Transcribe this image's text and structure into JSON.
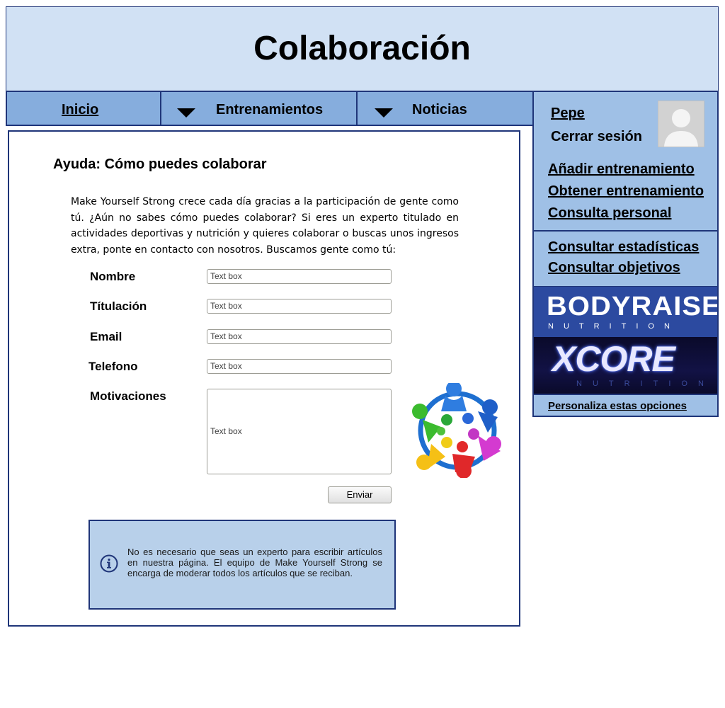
{
  "header": {
    "title": "Colaboración"
  },
  "nav": {
    "home": "Inicio",
    "trainings": "Entrenamientos",
    "news": "Noticias"
  },
  "help": {
    "title": "Ayuda: Cómo puedes colaborar",
    "intro": "Make Yourself Strong crece cada día gracias a la participación de gente como tú. ¿Aún no sabes cómo puedes colaborar? Si eres un experto titulado en actividades deportivas y nutrición y quieres colaborar o buscas unos ingresos extra, ponte en contacto con nosotros. Buscamos gente como tú:"
  },
  "form": {
    "name_label": "Nombre",
    "degree_label": "Títulación",
    "email_label": "Email",
    "phone_label": "Telefono",
    "motivation_label": "Motivaciones",
    "name_value": "Text box",
    "degree_value": "Text box",
    "email_value": "Text box",
    "phone_value": "Text box",
    "motivation_value": "Text box",
    "submit": "Enviar"
  },
  "notice": {
    "text": "No es necesario que seas un experto para escribir artículos en nuestra página. El equipo de Make Yourself Strong se encarga de moderar todos los artículos que se reciban."
  },
  "user": {
    "name": "Pepe",
    "logout": "Cerrar sesión"
  },
  "sidebar": {
    "menu1": [
      "Añadir entrenamiento",
      "Obtener entrenamiento",
      "Consulta personal"
    ],
    "menu2": [
      "Consultar estadísticas",
      "Consultar objetivos"
    ],
    "ads": [
      {
        "name": "BODYRAISE",
        "sub": "NUTRITION"
      },
      {
        "name": "XCORE",
        "sub": "NUTRITION"
      }
    ],
    "customize": "Personaliza estas opciones"
  },
  "colors": {
    "header_bg": "#d1e1f4",
    "nav_bg": "#86addd",
    "sidebar_bg": "#9fc0e6",
    "notice_bg": "#b8d0ea",
    "border": "#1f3579"
  }
}
